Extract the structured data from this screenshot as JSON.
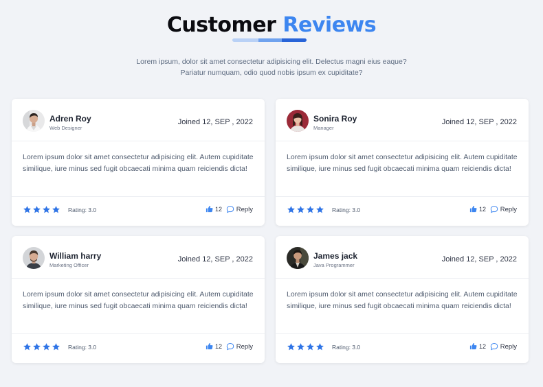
{
  "header": {
    "title_main": "Customer",
    "title_accent": "Reviews",
    "subtitle": "Lorem ipsum, dolor sit amet consectetur adipisicing elit. Delectus magni eius eaque? Pariatur numquam, odio quod nobis ipsum ex cupiditate?"
  },
  "colors": {
    "accent": "#3d86f0",
    "background": "#f1f3f7",
    "star": "#2f74e6"
  },
  "reviews": [
    {
      "name": "Adren Roy",
      "role": "Web Designer",
      "joined": "Joined 12, SEP , 2022",
      "text": "Lorem ipsum dolor sit amet consectetur adipisicing elit. Autem cupiditate similique, iure minus sed fugit obcaecati minima quam reiciendis dicta!",
      "stars": 4,
      "rating": "Rating: 3.0",
      "likes": "12",
      "reply_label": "Reply",
      "avatar_icon": "person-photo-icon"
    },
    {
      "name": "Sonira Roy",
      "role": "Manager",
      "joined": "Joined 12, SEP , 2022",
      "text": "Lorem ipsum dolor sit amet consectetur adipisicing elit. Autem cupiditate similique, iure minus sed fugit obcaecati minima quam reiciendis dicta!",
      "stars": 4,
      "rating": "Rating: 3.0",
      "likes": "12",
      "reply_label": "Reply",
      "avatar_icon": "person-photo-icon"
    },
    {
      "name": "William harry",
      "role": "Marketing Officer",
      "joined": "Joined 12, SEP , 2022",
      "text": "Lorem ipsum dolor sit amet consectetur adipisicing elit. Autem cupiditate similique, iure minus sed fugit obcaecati minima quam reiciendis dicta!",
      "stars": 4,
      "rating": "Rating: 3.0",
      "likes": "12",
      "reply_label": "Reply",
      "avatar_icon": "person-photo-icon"
    },
    {
      "name": "James jack",
      "role": "Java Programmer",
      "joined": "Joined 12, SEP , 2022",
      "text": "Lorem ipsum dolor sit amet consectetur adipisicing elit. Autem cupiditate similique, iure minus sed fugit obcaecati minima quam reiciendis dicta!",
      "stars": 4,
      "rating": "Rating: 3.0",
      "likes": "12",
      "reply_label": "Reply",
      "avatar_icon": "person-photo-icon"
    }
  ]
}
